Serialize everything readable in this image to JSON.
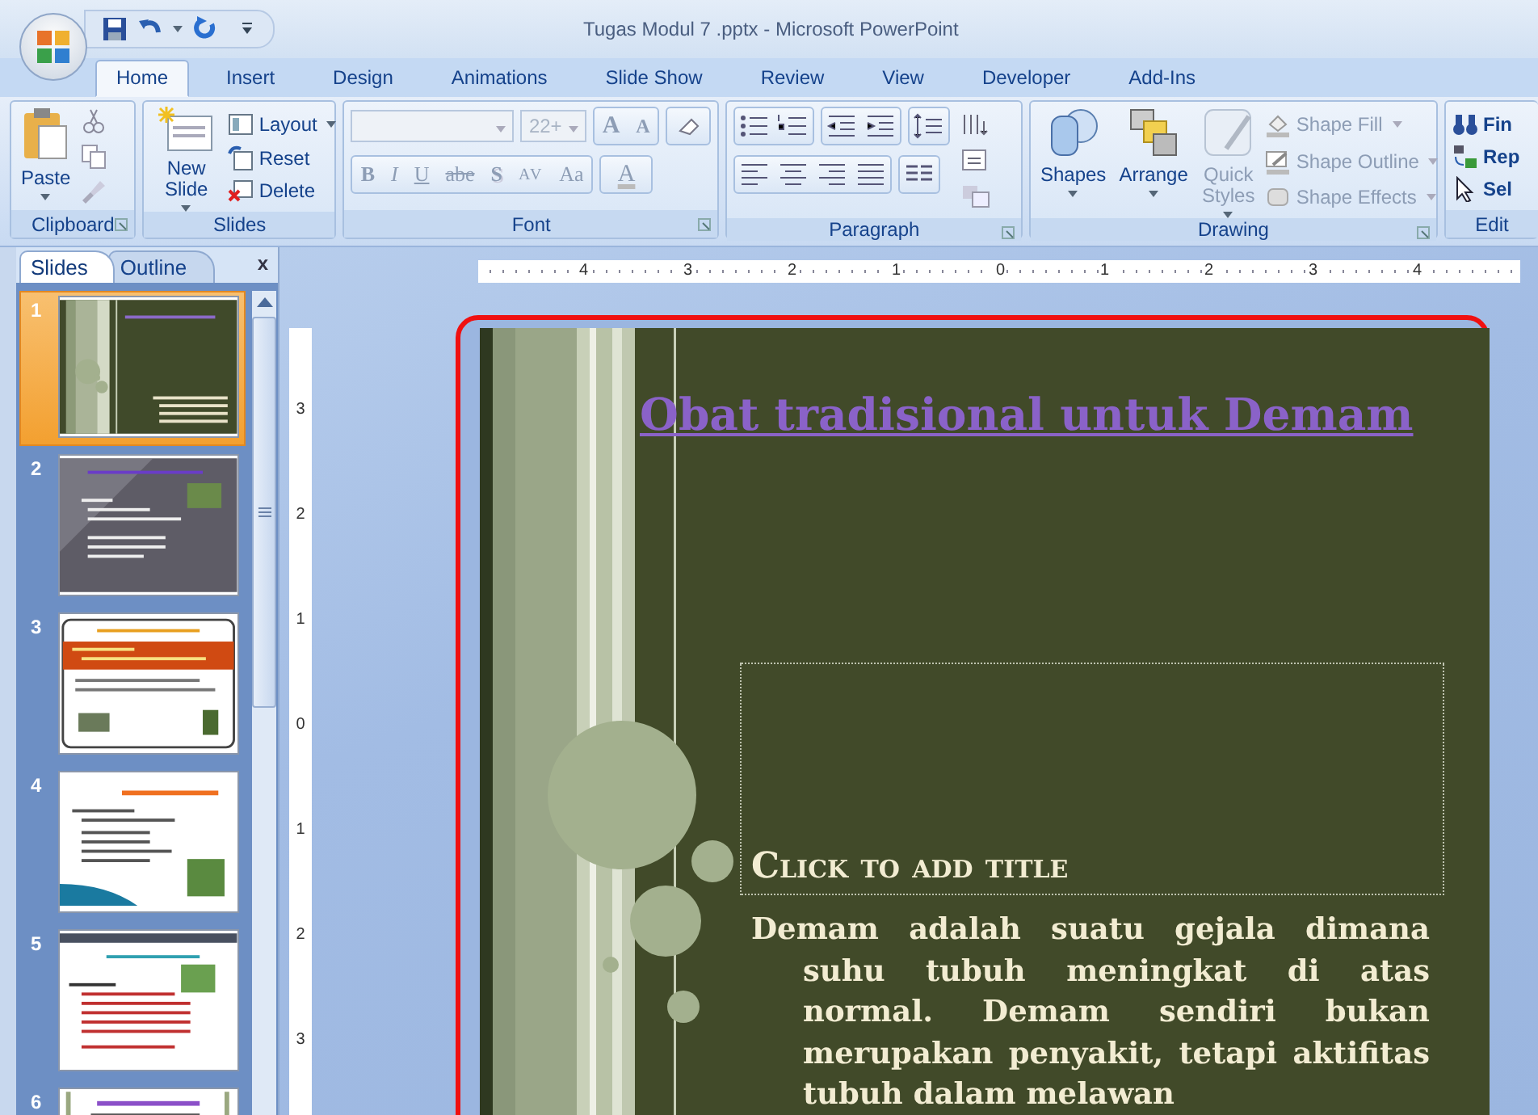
{
  "window": {
    "title": "Tugas Modul 7 .pptx - Microsoft PowerPoint"
  },
  "tabs": [
    {
      "label": "Home",
      "selected": true
    },
    {
      "label": "Insert",
      "selected": false
    },
    {
      "label": "Design",
      "selected": false
    },
    {
      "label": "Animations",
      "selected": false
    },
    {
      "label": "Slide Show",
      "selected": false
    },
    {
      "label": "Review",
      "selected": false
    },
    {
      "label": "View",
      "selected": false
    },
    {
      "label": "Developer",
      "selected": false
    },
    {
      "label": "Add-Ins",
      "selected": false
    }
  ],
  "clipboard": {
    "label": "Clipboard",
    "paste": "Paste"
  },
  "slides_group": {
    "label": "Slides",
    "new_slide": "New Slide",
    "buttons": [
      {
        "label": "Layout",
        "kind": "layout"
      },
      {
        "label": "Reset",
        "kind": "reset"
      },
      {
        "label": "Delete",
        "kind": "delete"
      }
    ]
  },
  "font": {
    "label": "Font",
    "size": "22+",
    "grow": "A",
    "shrink": "A",
    "format_buttons": [
      {
        "label": "B",
        "kind": "bold"
      },
      {
        "label": "I",
        "kind": "italic"
      },
      {
        "label": "U",
        "kind": "underline"
      },
      {
        "label": "abe",
        "kind": "strike"
      },
      {
        "label": "S",
        "kind": "shadow"
      },
      {
        "label": "AV",
        "kind": "spacing"
      },
      {
        "label": "Aa",
        "kind": "case"
      },
      {
        "label": "A",
        "kind": "color"
      }
    ]
  },
  "paragraph": {
    "label": "Paragraph"
  },
  "drawing": {
    "label": "Drawing",
    "large_buttons": [
      {
        "label": "Shapes",
        "kind": "shapes",
        "disabled": false
      },
      {
        "label": "Arrange",
        "kind": "arrange",
        "disabled": false
      },
      {
        "label": "Quick Styles",
        "kind": "styles",
        "disabled": true
      }
    ],
    "shape_buttons": [
      {
        "label": "Shape Fill",
        "kind": "fill",
        "disabled": true
      },
      {
        "label": "Shape Outline",
        "kind": "outline",
        "disabled": true
      },
      {
        "label": "Shape Effects",
        "kind": "effects",
        "disabled": true
      }
    ]
  },
  "editing": {
    "label": "Edit",
    "buttons": [
      {
        "label": "Fin",
        "kind": "find"
      },
      {
        "label": "Rep",
        "kind": "replace"
      },
      {
        "label": "Sel",
        "kind": "select"
      }
    ]
  },
  "pane_tabs": [
    {
      "label": "Slides",
      "selected": true
    },
    {
      "label": "Outline",
      "selected": false
    }
  ],
  "pane_close": "x",
  "thumbnails": [
    {
      "number": "1",
      "selected": true,
      "kind": "olive"
    },
    {
      "number": "2",
      "selected": false,
      "kind": "gray"
    },
    {
      "number": "3",
      "selected": false,
      "kind": "orange"
    },
    {
      "number": "4",
      "selected": false,
      "kind": "swoosh"
    },
    {
      "number": "5",
      "selected": false,
      "kind": "slate"
    },
    {
      "number": "6",
      "selected": false,
      "kind": "purple"
    }
  ],
  "ruler": {
    "horizontal": [
      "4",
      "3",
      "2",
      "1",
      "0",
      "1",
      "2",
      "3",
      "4"
    ],
    "vertical": [
      "3",
      "2",
      "1",
      "0",
      "1",
      "2",
      "3"
    ]
  },
  "slide": {
    "title": "Obat tradisional untuk Demam",
    "title_placeholder": "Click to add title",
    "body": "Demam adalah suatu gejala dimana suhu tubuh meningkat di atas normal. Demam sendiri bukan merupakan penyakit, tetapi aktifitas tubuh dalam melawan"
  }
}
